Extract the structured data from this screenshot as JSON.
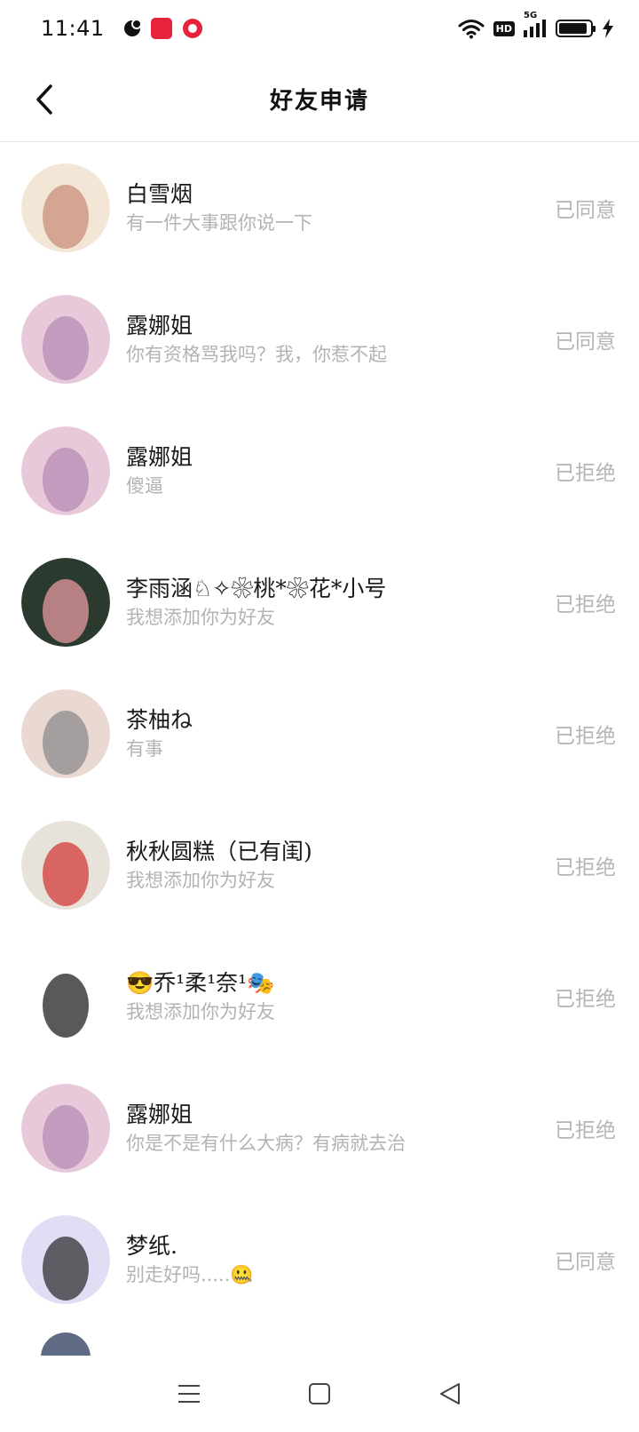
{
  "status_bar": {
    "time": "11:41",
    "hd_label": "HD",
    "signal_label": "5G",
    "battery_level": 0.9,
    "notification_icons": [
      "app-icon",
      "xiaohongshu-icon",
      "record-icon"
    ]
  },
  "header": {
    "title": "好友申请"
  },
  "requests": [
    {
      "name": "白雪烟",
      "message": "有一件大事跟你说一下",
      "status": "已同意",
      "avatar_colors": [
        "#f3e6d6",
        "#c98f7c"
      ]
    },
    {
      "name": "露娜姐",
      "message": "你有资格骂我吗？我，你惹不起",
      "status": "已同意",
      "avatar_colors": [
        "#e8c9d9",
        "#b58bb5"
      ]
    },
    {
      "name": "露娜姐",
      "message": "傻逼",
      "status": "已拒绝",
      "avatar_colors": [
        "#e8c9d9",
        "#b58bb5"
      ]
    },
    {
      "name": "李雨涵♘✧❀桃*❀花*小号",
      "message": "我想添加你为好友",
      "status": "已拒绝",
      "avatar_colors": [
        "#2b3a2f",
        "#e79aa0"
      ]
    },
    {
      "name": "茶柚ね",
      "message": "有事",
      "status": "已拒绝",
      "avatar_colors": [
        "#e9d9d2",
        "#8d8a8e"
      ]
    },
    {
      "name": "秋秋圆糕（已有闺)",
      "message": "我想添加你为好友",
      "status": "已拒绝",
      "avatar_colors": [
        "#e7e2da",
        "#d43b3b"
      ]
    },
    {
      "name": "😎乔¹柔¹奈¹🎭",
      "message": "我想添加你为好友",
      "status": "已拒绝",
      "avatar_colors": [
        "#ffffff",
        "#222222"
      ]
    },
    {
      "name": "露娜姐",
      "message": "你是不是有什么大病？有病就去治",
      "status": "已拒绝",
      "avatar_colors": [
        "#e8c9d9",
        "#b58bb5"
      ]
    },
    {
      "name": "梦纸.",
      "message": "别走好吗.....🤐",
      "status": "已同意",
      "avatar_colors": [
        "#e3dcf5",
        "#333333"
      ]
    }
  ],
  "colors": {
    "status_text": "#b5b5b5",
    "message_text": "#b3b3b3",
    "divider": "#e6e6e6"
  },
  "nav_bar": {
    "icons": [
      "menu-icon",
      "home-square-icon",
      "back-triangle-icon"
    ]
  }
}
